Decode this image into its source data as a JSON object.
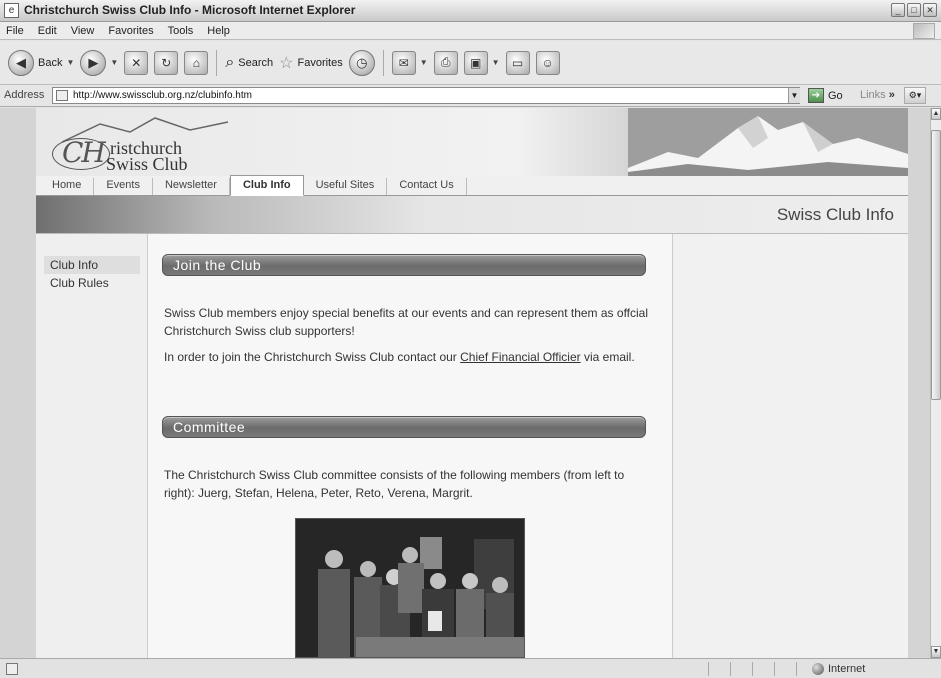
{
  "window": {
    "title": "Christchurch Swiss Club Info - Microsoft Internet Explorer"
  },
  "menu": {
    "items": [
      "File",
      "Edit",
      "View",
      "Favorites",
      "Tools",
      "Help"
    ]
  },
  "toolbar": {
    "back_label": "Back",
    "search_label": "Search",
    "favorites_label": "Favorites"
  },
  "address": {
    "label": "Address",
    "url": "http://www.swissclub.org.nz/clubinfo.htm",
    "go_label": "Go",
    "links_label": "Links"
  },
  "site": {
    "logo_line1": "ristchurch",
    "logo_line2": "Swiss Club",
    "logo_mark": "CH",
    "tabs": [
      "Home",
      "Events",
      "Newsletter",
      "Club Info",
      "Useful Sites",
      "Contact Us"
    ],
    "active_tab": "Club Info",
    "page_title": "Swiss Club Info",
    "leftnav": [
      "Club Info",
      "Club Rules"
    ],
    "sections": {
      "join_title": "Join the Club",
      "join_p1": "Swiss Club members enjoy special benefits at our events and can represent them as offcial Christchurch Swiss club supporters!",
      "join_p2_before": "In order to join the Christchurch Swiss Club contact our ",
      "join_p2_link": "Chief Financial Officier",
      "join_p2_after": " via email.",
      "committee_title": "Committee",
      "committee_p": "The Christchurch Swiss Club committee consists of the following members (from left to right): Juerg, Stefan, Helena, Peter, Reto, Verena, Margrit."
    }
  },
  "status": {
    "zone": "Internet"
  }
}
